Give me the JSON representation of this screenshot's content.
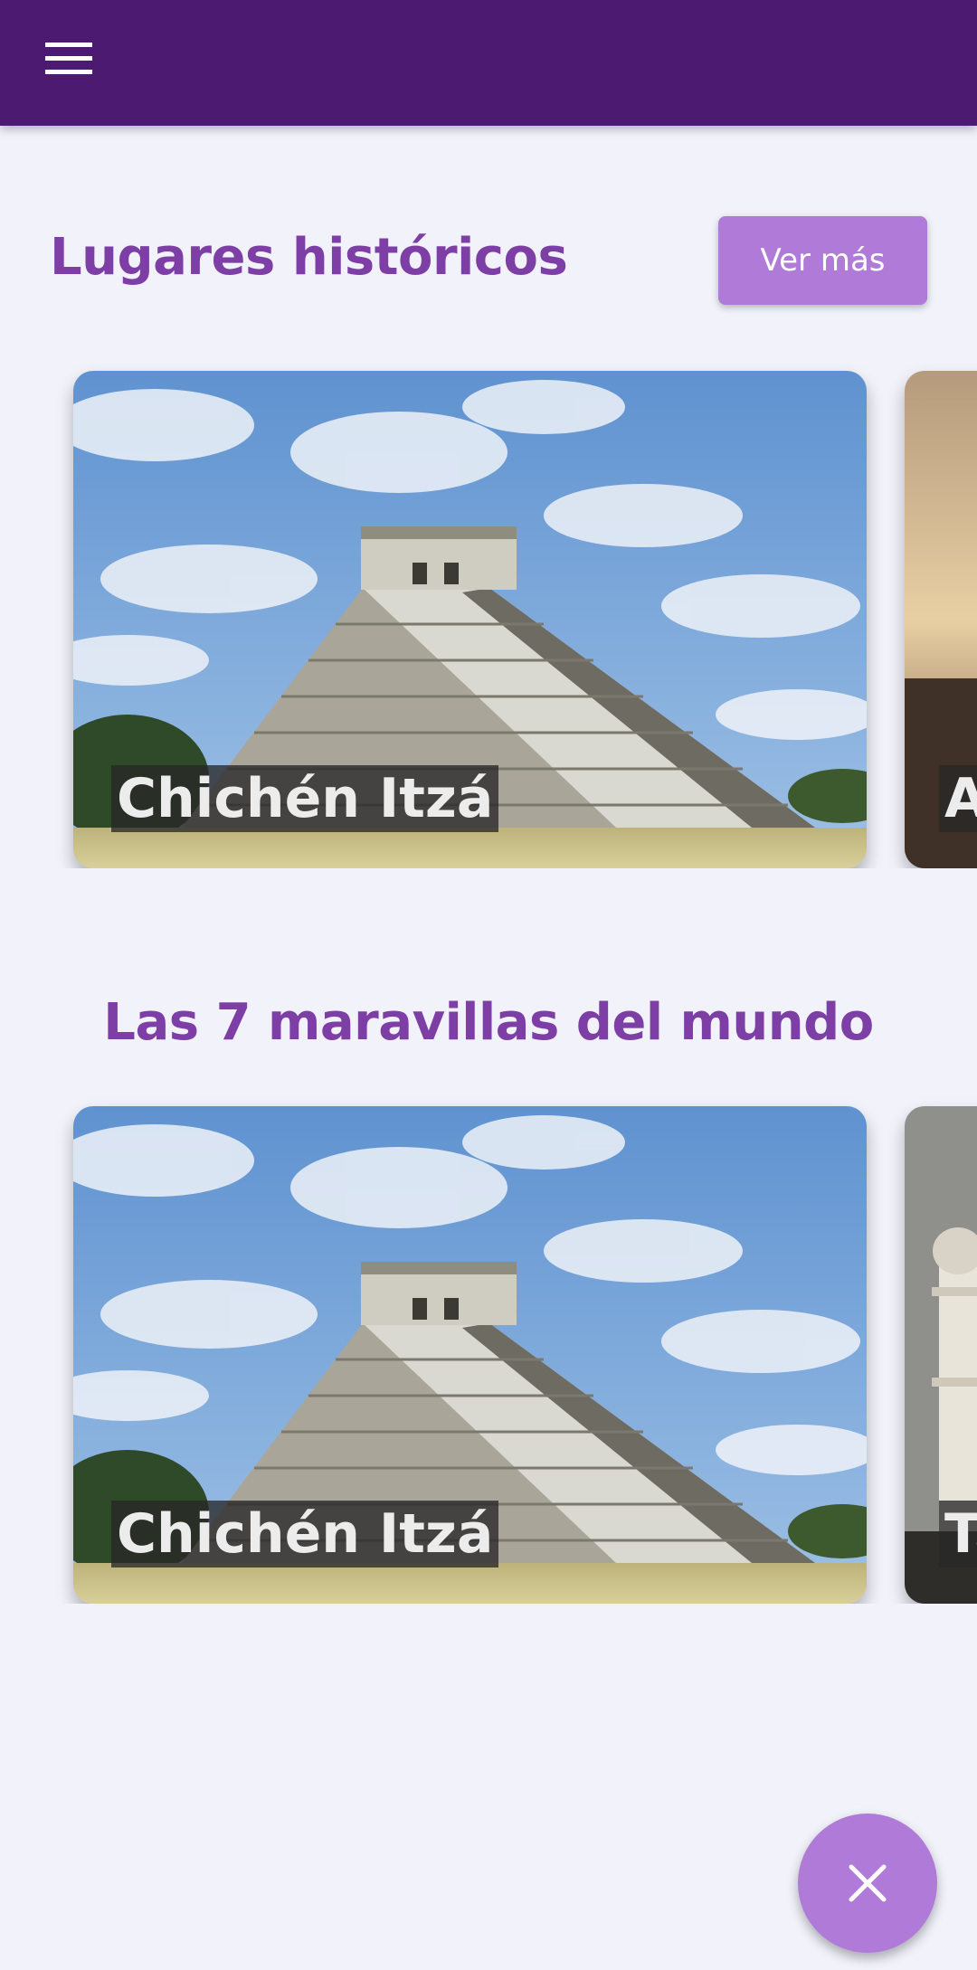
{
  "app_bar": {
    "menu_icon": "hamburger-menu-icon",
    "color": "#4d1a71"
  },
  "sections": [
    {
      "title": "Lugares históricos",
      "button_label": "Ver más",
      "cards": [
        {
          "label": "Chichén Itzá",
          "image": "chichen-itza-pyramid"
        },
        {
          "label": "A",
          "image": "sunset-ruins"
        }
      ]
    },
    {
      "title": "Las 7 maravillas del mundo",
      "cards": [
        {
          "label": "Chichén Itzá",
          "image": "chichen-itza-pyramid"
        },
        {
          "label": "Ta",
          "image": "taj-mahal-minaret"
        }
      ]
    }
  ],
  "fab": {
    "icon": "close-icon"
  },
  "colors": {
    "accent": "#b07ad9",
    "title": "#7d3fa6",
    "background": "#f1f2fa"
  }
}
